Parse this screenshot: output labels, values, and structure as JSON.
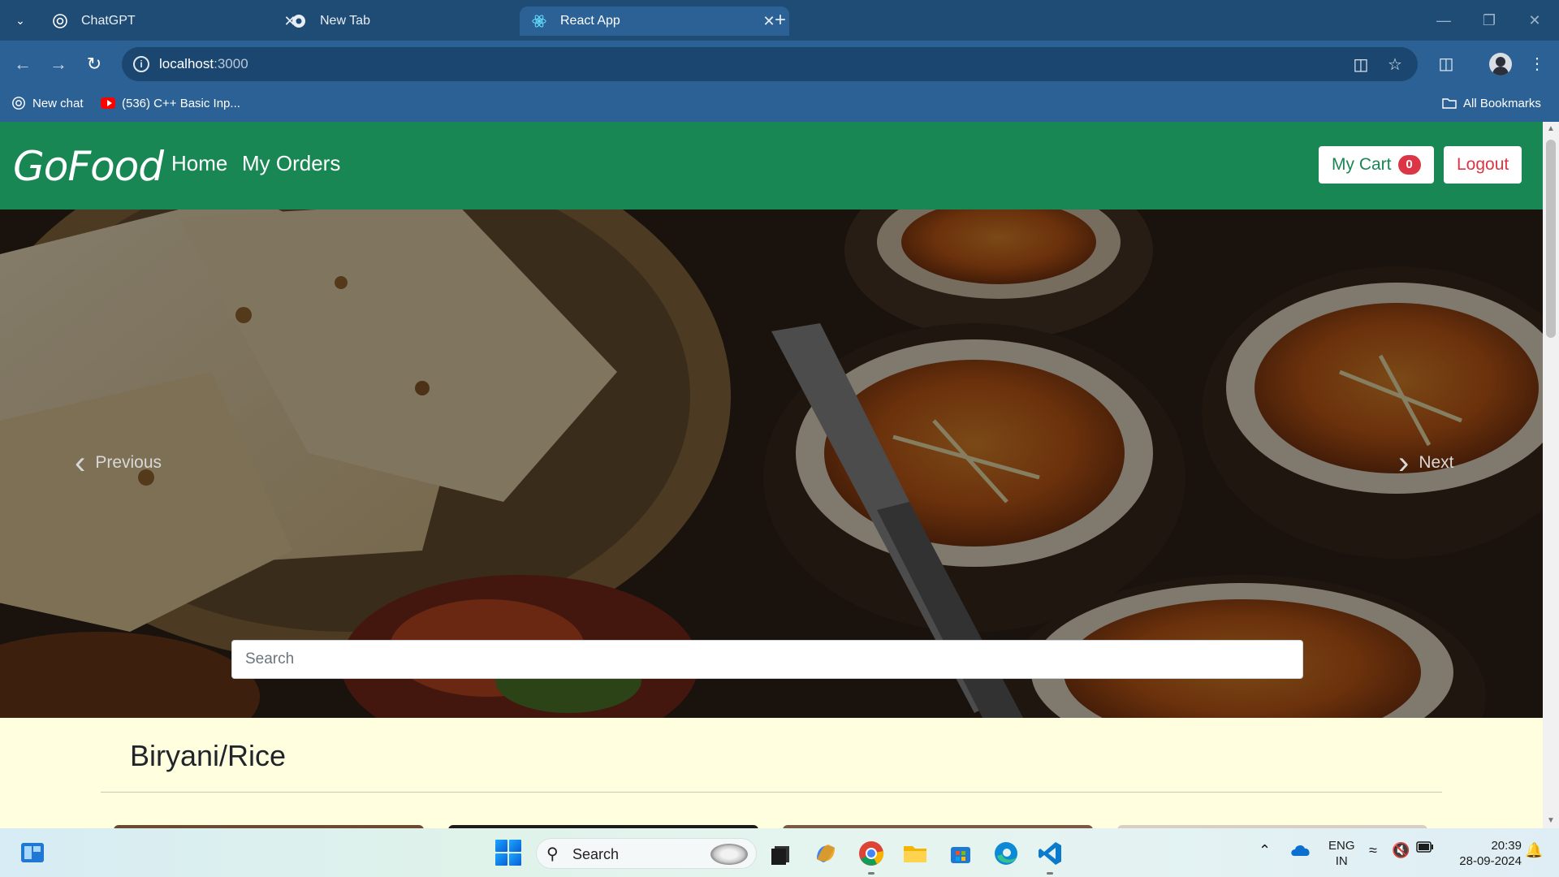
{
  "browser": {
    "tabs": [
      {
        "title": "ChatGPT",
        "active": false,
        "icon": "chatgpt-icon"
      },
      {
        "title": "New Tab",
        "active": false,
        "icon": "chrome-icon"
      },
      {
        "title": "React App",
        "active": true,
        "icon": "react-icon"
      }
    ],
    "url_host": "localhost",
    "url_port": ":3000",
    "bookmarks": [
      {
        "label": "New chat",
        "icon": "chatgpt-icon"
      },
      {
        "label": "(536) C++ Basic Inp...",
        "icon": "youtube-icon"
      }
    ],
    "all_bookmarks_label": "All Bookmarks"
  },
  "navbar": {
    "brand": "GoFood",
    "links": [
      "Home",
      "My Orders"
    ],
    "cart_label": "My Cart",
    "cart_count": "0",
    "logout_label": "Logout",
    "color": "#198754"
  },
  "carousel": {
    "prev_label": "Previous",
    "next_label": "Next",
    "search_placeholder": "Search"
  },
  "section": {
    "title": "Biryani/Rice"
  },
  "taskbar": {
    "search_label": "Search",
    "language": "ENG",
    "region": "IN",
    "time": "20:39",
    "date": "28-09-2024"
  }
}
